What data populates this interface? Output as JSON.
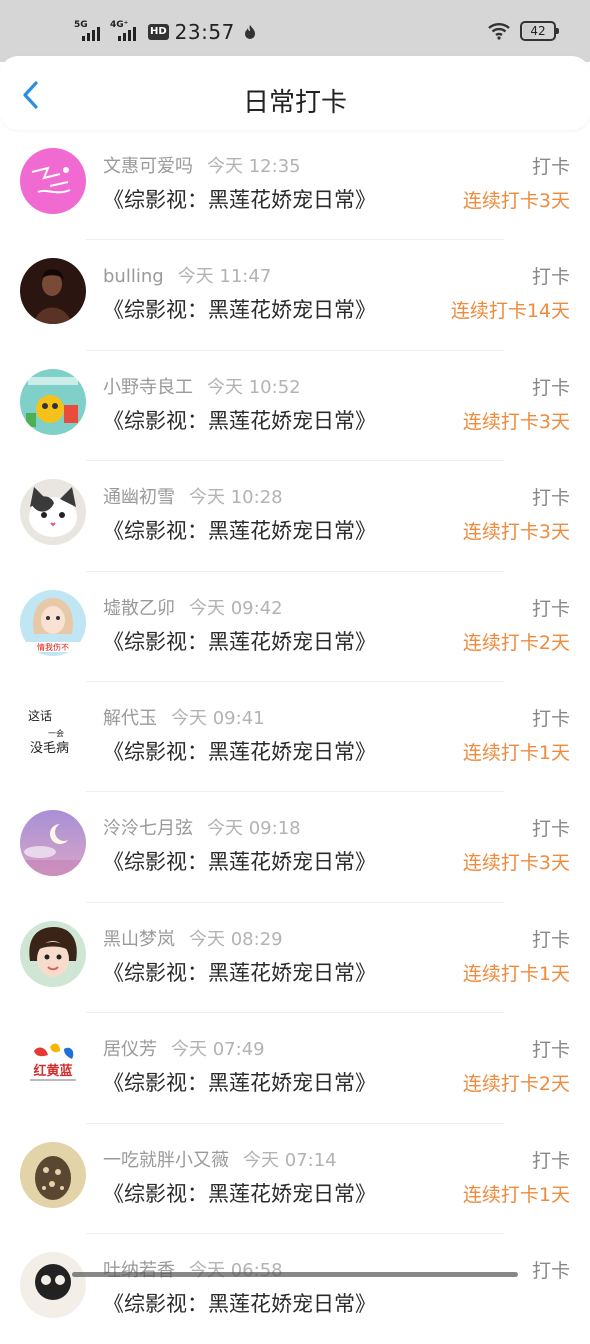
{
  "status_bar": {
    "net1": "5G",
    "net2": "4G⁺",
    "hd": "HD",
    "time": "23:57",
    "battery": "42"
  },
  "header": {
    "title": "日常打卡",
    "back_icon": "chevron-left-icon"
  },
  "colors": {
    "accent": "#2a8fe0",
    "streak": "#f08a3c",
    "divider": "#eeeeee"
  },
  "checkins": [
    {
      "name": "文惠可爱吗",
      "time": "今天 12:35",
      "book": "《综影视：黑莲花娇宠日常》",
      "tag": "打卡",
      "streak": "连续打卡3天",
      "avatar_icon": "pink-avatar-icon"
    },
    {
      "name": "bulling",
      "time": "今天 11:47",
      "book": "《综影视：黑莲花娇宠日常》",
      "tag": "打卡",
      "streak": "连续打卡14天",
      "avatar_icon": "dark-portrait-avatar-icon"
    },
    {
      "name": "小野寺良工",
      "time": "今天 10:52",
      "book": "《综影视：黑莲花娇宠日常》",
      "tag": "打卡",
      "streak": "连续打卡3天",
      "avatar_icon": "cartoon-avatar-icon"
    },
    {
      "name": "通幽初雪",
      "time": "今天 10:28",
      "book": "《综影视：黑莲花娇宠日常》",
      "tag": "打卡",
      "streak": "连续打卡3天",
      "avatar_icon": "cat-avatar-icon"
    },
    {
      "name": "墟散乙卯",
      "time": "今天 09:42",
      "book": "《综影视：黑莲花娇宠日常》",
      "tag": "打卡",
      "streak": "连续打卡2天",
      "avatar_icon": "girl-avatar-icon"
    },
    {
      "name": "解代玉",
      "time": "今天 09:41",
      "book": "《综影视：黑莲花娇宠日常》",
      "tag": "打卡",
      "streak": "连续打卡1天",
      "avatar_icon": "text-avatar-icon"
    },
    {
      "name": "泠泠七月弦",
      "time": "今天 09:18",
      "book": "《综影视：黑莲花娇宠日常》",
      "tag": "打卡",
      "streak": "连续打卡3天",
      "avatar_icon": "moon-avatar-icon"
    },
    {
      "name": "黑山梦岚",
      "time": "今天 08:29",
      "book": "《综影视：黑莲花娇宠日常》",
      "tag": "打卡",
      "streak": "连续打卡1天",
      "avatar_icon": "child-avatar-icon"
    },
    {
      "name": "居仪芳",
      "time": "今天 07:49",
      "book": "《综影视：黑莲花娇宠日常》",
      "tag": "打卡",
      "streak": "连续打卡2天",
      "avatar_icon": "logo-avatar-icon"
    },
    {
      "name": "一吃就胖小又薇",
      "time": "今天 07:14",
      "book": "《综影视：黑莲花娇宠日常》",
      "tag": "打卡",
      "streak": "连续打卡1天",
      "avatar_icon": "cookie-avatar-icon"
    },
    {
      "name": "吐纳若香",
      "time": "今天 06:58",
      "book": "《综影视：黑莲花娇宠日常》",
      "tag": "打卡",
      "streak": "",
      "avatar_icon": "skull-avatar-icon"
    }
  ],
  "avatar_text": {
    "row6_top": "这话",
    "row6_mid": "一会",
    "row6_bottom": "没毛病",
    "row9_brand": "红黄蓝",
    "row5_banner": "情我伤不"
  }
}
